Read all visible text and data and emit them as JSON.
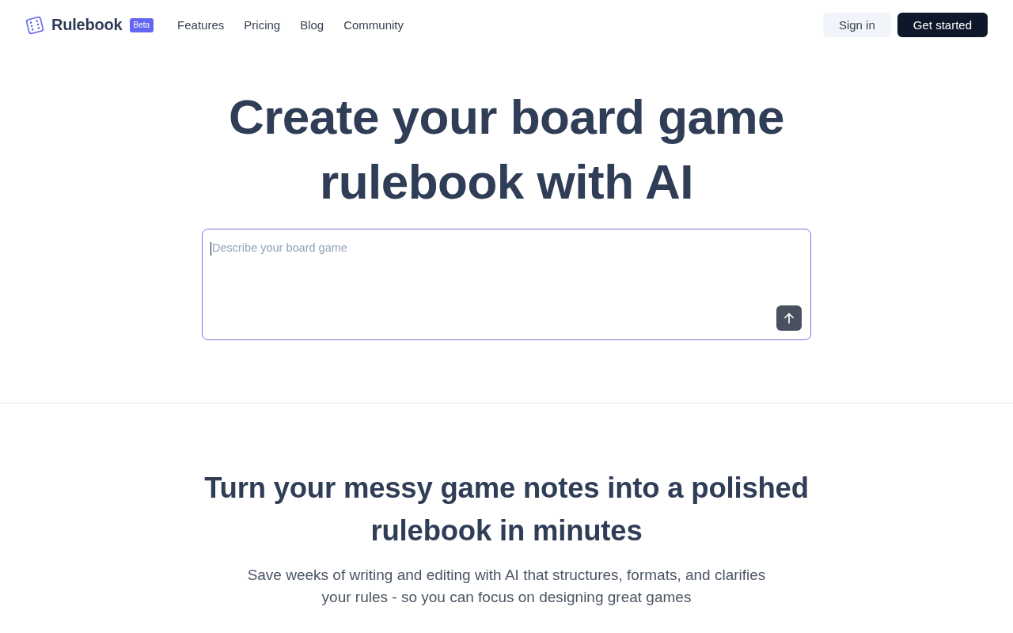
{
  "header": {
    "brand": {
      "name": "Rulebook",
      "badge": "Beta"
    },
    "nav": [
      {
        "label": "Features"
      },
      {
        "label": "Pricing"
      },
      {
        "label": "Blog"
      },
      {
        "label": "Community"
      }
    ],
    "actions": [
      {
        "label": "Sign in",
        "kind": "secondary"
      },
      {
        "label": "Get started",
        "kind": "primary"
      }
    ]
  },
  "hero": {
    "title": "Create your board game rulebook with AI",
    "prompt": {
      "placeholder": "Describe your board game",
      "focused": true
    }
  },
  "intro": {
    "title": "Turn your messy game notes into a polished rulebook in minutes",
    "text": "Save weeks of writing and editing with AI that structures, formats, and clarifies your rules - so you can focus on designing great games"
  }
}
